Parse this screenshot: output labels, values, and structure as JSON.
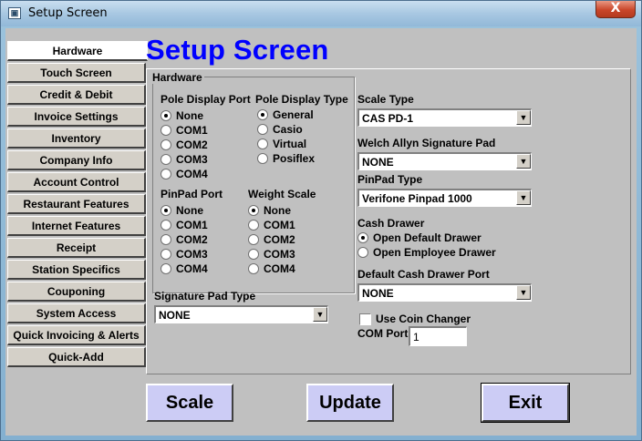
{
  "window": {
    "title": "Setup Screen",
    "close_label": "X"
  },
  "page_title": "Setup Screen",
  "sidebar": {
    "items": [
      {
        "label": "Hardware"
      },
      {
        "label": "Touch Screen"
      },
      {
        "label": "Credit & Debit"
      },
      {
        "label": "Invoice Settings"
      },
      {
        "label": "Inventory"
      },
      {
        "label": "Company Info"
      },
      {
        "label": "Account Control"
      },
      {
        "label": "Restaurant Features"
      },
      {
        "label": "Internet Features"
      },
      {
        "label": "Receipt"
      },
      {
        "label": "Station Specifics"
      },
      {
        "label": "Couponing"
      },
      {
        "label": "System Access"
      },
      {
        "label": "Quick Invoicing & Alerts"
      },
      {
        "label": "Quick-Add"
      }
    ]
  },
  "hardware": {
    "group_label": "Hardware",
    "pole_port": {
      "label": "Pole Display Port",
      "options": [
        "None",
        "COM1",
        "COM2",
        "COM3",
        "COM4"
      ],
      "selected": 0
    },
    "pole_type": {
      "label": "Pole Display Type",
      "options": [
        "General",
        "Casio",
        "Virtual",
        "Posiflex"
      ],
      "selected": 0
    },
    "pinpad_port": {
      "label": "PinPad Port",
      "options": [
        "None",
        "COM1",
        "COM2",
        "COM3",
        "COM4"
      ],
      "selected": 0
    },
    "weight_scale": {
      "label": "Weight Scale",
      "options": [
        "None",
        "COM1",
        "COM2",
        "COM3",
        "COM4"
      ],
      "selected": 0
    },
    "signature_pad_type": {
      "label": "Signature Pad Type",
      "value": "NONE"
    },
    "scale_type": {
      "label": "Scale Type",
      "value": "CAS PD-1"
    },
    "welch_allyn": {
      "label": "Welch Allyn Signature Pad",
      "value": "NONE"
    },
    "pinpad_type": {
      "label": "PinPad Type",
      "value": "Verifone Pinpad 1000"
    },
    "cash_drawer": {
      "label": "Cash Drawer",
      "options": [
        "Open Default Drawer",
        "Open Employee Drawer"
      ],
      "selected": 0
    },
    "default_drawer_port": {
      "label": "Default Cash Drawer Port",
      "value": "NONE"
    },
    "coin_changer": {
      "label": "Use Coin Changer",
      "checked": false
    },
    "com_port": {
      "label": "COM Port",
      "value": "1"
    }
  },
  "buttons": {
    "scale": "Scale",
    "update": "Update",
    "exit": "Exit"
  }
}
